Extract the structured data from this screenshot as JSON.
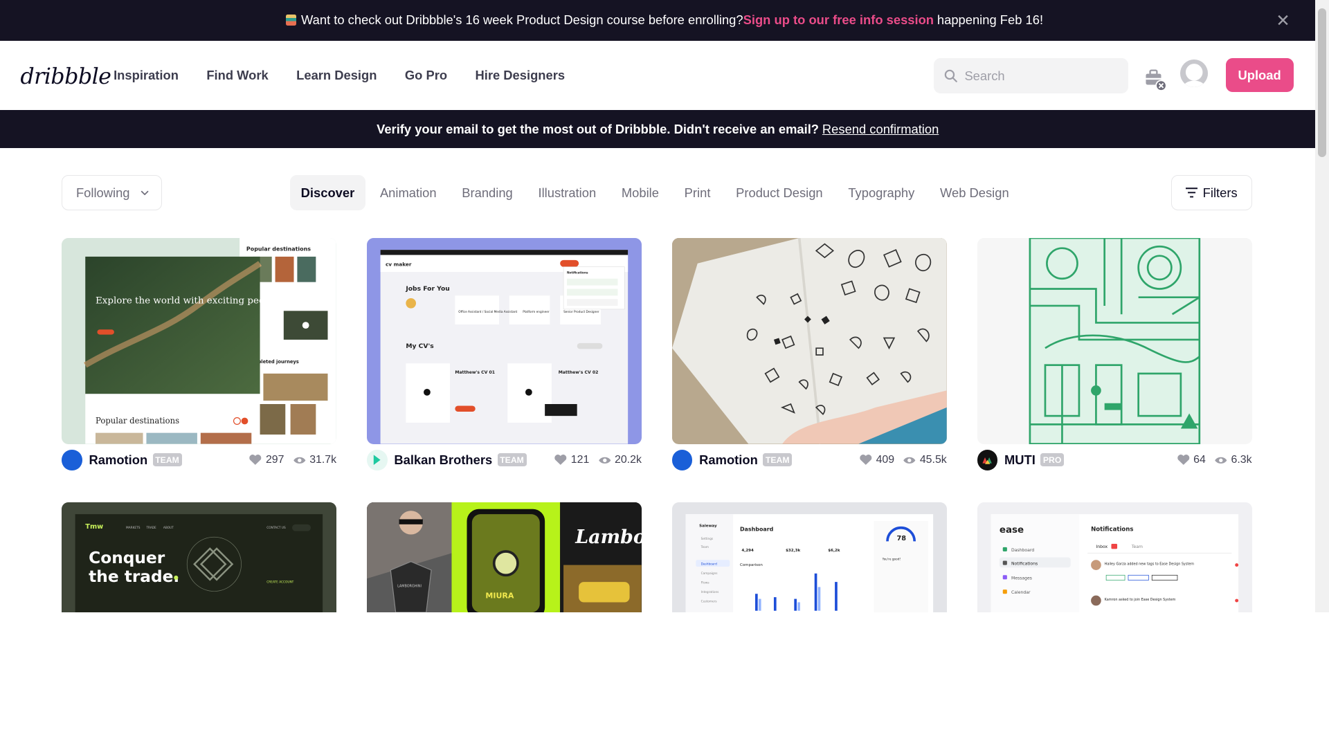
{
  "announcement": {
    "text_before": "Want to check out Dribbble's 16 week Product Design course before enrolling? ",
    "link": "Sign up to our free info session",
    "text_after": " happening Feb 16!"
  },
  "header": {
    "logo": "dribbble",
    "nav": [
      "Inspiration",
      "Find Work",
      "Learn Design",
      "Go Pro",
      "Hire Designers"
    ],
    "search_placeholder": "Search",
    "upload_label": "Upload"
  },
  "verify": {
    "text": "Verify your email to get the most out of Dribbble. Didn't receive an email?",
    "link": "Resend confirmation"
  },
  "filters_bar": {
    "following_label": "Following",
    "categories": [
      "Discover",
      "Animation",
      "Branding",
      "Illustration",
      "Mobile",
      "Print",
      "Product Design",
      "Typography",
      "Web Design"
    ],
    "active_category": "Discover",
    "filters_label": "Filters"
  },
  "shots": [
    {
      "author": "Ramotion",
      "badge": "TEAM",
      "likes": "297",
      "views": "31.7k",
      "art": {
        "headline": "Explore the world with exciting people",
        "side_title": "Popular destinations",
        "bottom_title": "Popular destinations",
        "completed": "Completed journeys"
      }
    },
    {
      "author": "Balkan Brothers",
      "badge": "TEAM",
      "likes": "121",
      "views": "20.2k",
      "art": {
        "logo": "cv maker",
        "jobs": "Jobs For You",
        "cvs": "My CV's",
        "cv1": "Matthew's CV 01",
        "cv2": "Matthew's CV 02",
        "job1": "Office Assistant / Social Media Assistant",
        "job2": "Platform engineer",
        "job3": "Senior Product Designer",
        "notif": "Notifications"
      }
    },
    {
      "author": "Ramotion",
      "badge": "TEAM",
      "likes": "409",
      "views": "45.5k",
      "art": {}
    },
    {
      "author": "MUTI",
      "badge": "PRO",
      "likes": "64",
      "views": "6.3k",
      "art": {}
    },
    {
      "art": {
        "brand": "Tmw",
        "nav": [
          "MARKETS",
          "TRADE",
          "ABOUT",
          "CONTACT US"
        ],
        "headline1": "Conquer",
        "headline2": "the trade.",
        "cta": "CREATE ACCOUNT"
      }
    },
    {
      "art": {
        "car": "LAMBORGHINI",
        "model": "MIURA",
        "word": "Lambo"
      }
    },
    {
      "art": {
        "brand": "Saleway",
        "title": "Dashboard",
        "score": "78",
        "stat1": "4,294",
        "stat2": "$32,3k",
        "stat3": "$6,2k",
        "comparison": "Comparison",
        "good": "You're good!",
        "menu": [
          "Settings",
          "Team",
          "Dashboard",
          "Campaigns",
          "Flows",
          "Integrations",
          "Customers"
        ]
      }
    },
    {
      "art": {
        "brand": "ease",
        "title": "Notifications",
        "tabs": [
          "Inbox",
          "Team"
        ],
        "menu": [
          "Dashboard",
          "Notifications",
          "Messages",
          "Calendar"
        ],
        "n1": "Hailey Garza added new tags to Ease Design System",
        "n2": "Kamron asked to join Ease Design System"
      }
    }
  ]
}
